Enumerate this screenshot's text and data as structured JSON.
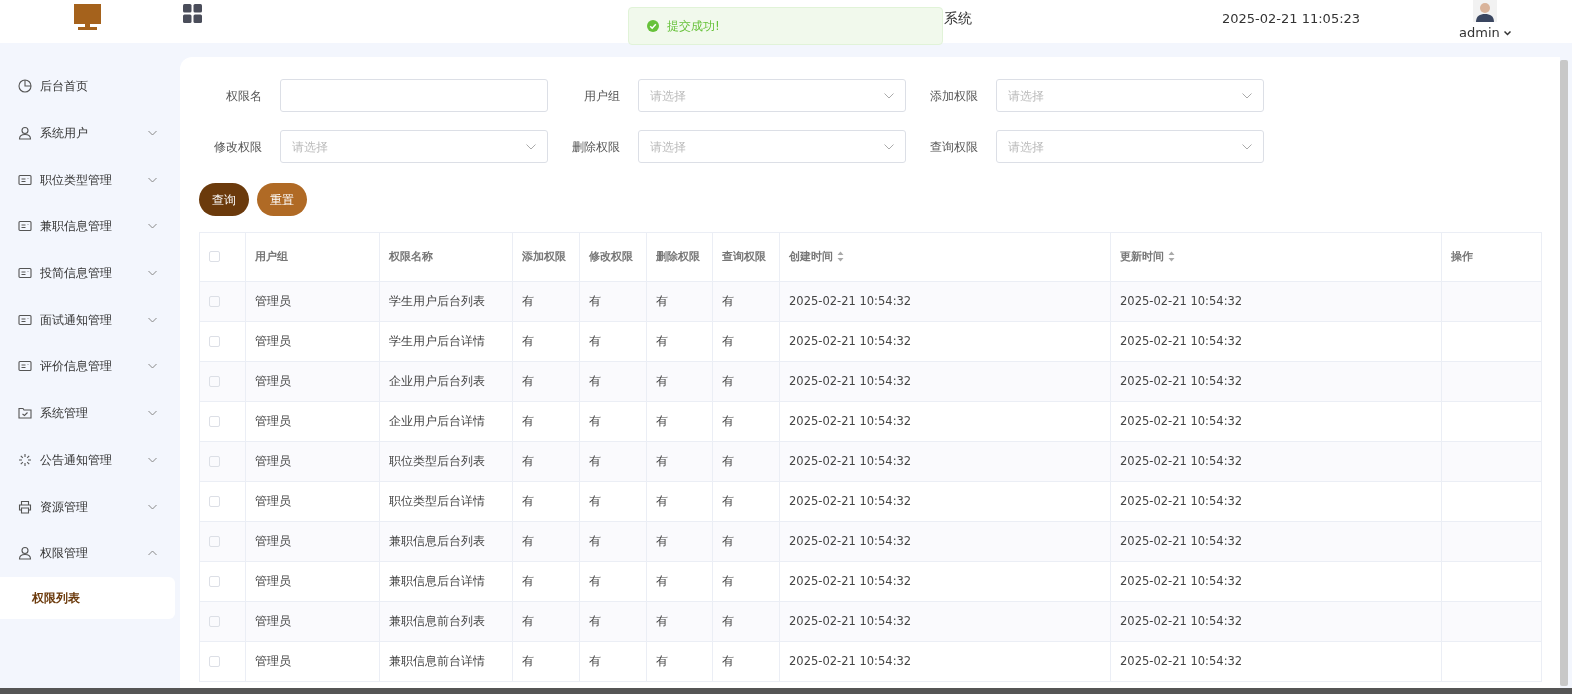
{
  "header": {
    "title": "系统",
    "toast": {
      "message": "提交成功!"
    },
    "datetime": "2025-02-21 11:05:23",
    "user": {
      "name": "admin"
    }
  },
  "sidebar": {
    "items": [
      {
        "label": "后台首页"
      },
      {
        "label": "系统用户",
        "expanded": false
      },
      {
        "label": "职位类型管理",
        "expanded": false
      },
      {
        "label": "兼职信息管理",
        "expanded": false
      },
      {
        "label": "投简信息管理",
        "expanded": false
      },
      {
        "label": "面试通知管理",
        "expanded": false
      },
      {
        "label": "评价信息管理",
        "expanded": false
      },
      {
        "label": "系统管理",
        "expanded": false
      },
      {
        "label": "公告通知管理",
        "expanded": false
      },
      {
        "label": "资源管理",
        "expanded": false
      },
      {
        "label": "权限管理",
        "expanded": true,
        "children": [
          {
            "label": "权限列表",
            "selected": true
          }
        ]
      }
    ]
  },
  "filters": [
    {
      "label": "权限名",
      "kind": "text"
    },
    {
      "label": "用户组",
      "kind": "select",
      "placeholder": "请选择"
    },
    {
      "label": "添加权限",
      "kind": "select",
      "placeholder": "请选择"
    },
    {
      "label": "修改权限",
      "kind": "select",
      "placeholder": "请选择"
    },
    {
      "label": "删除权限",
      "kind": "select",
      "placeholder": "请选择"
    },
    {
      "label": "查询权限",
      "kind": "select",
      "placeholder": "请选择"
    }
  ],
  "buttons": [
    {
      "label": "查询",
      "kind": "primary"
    },
    {
      "label": "重置",
      "kind": "secondary"
    }
  ],
  "table": {
    "all_checked": false,
    "columns": [
      {
        "label": "用户组",
        "sortable": false
      },
      {
        "label": "权限名称",
        "sortable": false
      },
      {
        "label": "添加权限",
        "sortable": false
      },
      {
        "label": "修改权限",
        "sortable": false
      },
      {
        "label": "删除权限",
        "sortable": false
      },
      {
        "label": "查询权限",
        "sortable": false
      },
      {
        "label": "创建时间",
        "sortable": true
      },
      {
        "label": "更新时间",
        "sortable": true
      },
      {
        "label": "操作",
        "sortable": false
      }
    ],
    "rows": [
      {
        "checked": false,
        "cells": [
          "管理员",
          "学生用户后台列表",
          "有",
          "有",
          "有",
          "有",
          "2025-02-21 10:54:32",
          "2025-02-21 10:54:32"
        ]
      },
      {
        "checked": false,
        "cells": [
          "管理员",
          "学生用户后台详情",
          "有",
          "有",
          "有",
          "有",
          "2025-02-21 10:54:32",
          "2025-02-21 10:54:32"
        ]
      },
      {
        "checked": false,
        "cells": [
          "管理员",
          "企业用户后台列表",
          "有",
          "有",
          "有",
          "有",
          "2025-02-21 10:54:32",
          "2025-02-21 10:54:32"
        ]
      },
      {
        "checked": false,
        "cells": [
          "管理员",
          "企业用户后台详情",
          "有",
          "有",
          "有",
          "有",
          "2025-02-21 10:54:32",
          "2025-02-21 10:54:32"
        ]
      },
      {
        "checked": false,
        "cells": [
          "管理员",
          "职位类型后台列表",
          "有",
          "有",
          "有",
          "有",
          "2025-02-21 10:54:32",
          "2025-02-21 10:54:32"
        ]
      },
      {
        "checked": false,
        "cells": [
          "管理员",
          "职位类型后台详情",
          "有",
          "有",
          "有",
          "有",
          "2025-02-21 10:54:32",
          "2025-02-21 10:54:32"
        ]
      },
      {
        "checked": false,
        "cells": [
          "管理员",
          "兼职信息后台列表",
          "有",
          "有",
          "有",
          "有",
          "2025-02-21 10:54:32",
          "2025-02-21 10:54:32"
        ]
      },
      {
        "checked": false,
        "cells": [
          "管理员",
          "兼职信息后台详情",
          "有",
          "有",
          "有",
          "有",
          "2025-02-21 10:54:32",
          "2025-02-21 10:54:32"
        ]
      },
      {
        "checked": false,
        "cells": [
          "管理员",
          "兼职信息前台列表",
          "有",
          "有",
          "有",
          "有",
          "2025-02-21 10:54:32",
          "2025-02-21 10:54:32"
        ]
      },
      {
        "checked": false,
        "cells": [
          "管理员",
          "兼职信息前台详情",
          "有",
          "有",
          "有",
          "有",
          "2025-02-21 10:54:32",
          "2025-02-21 10:54:32"
        ]
      }
    ]
  }
}
